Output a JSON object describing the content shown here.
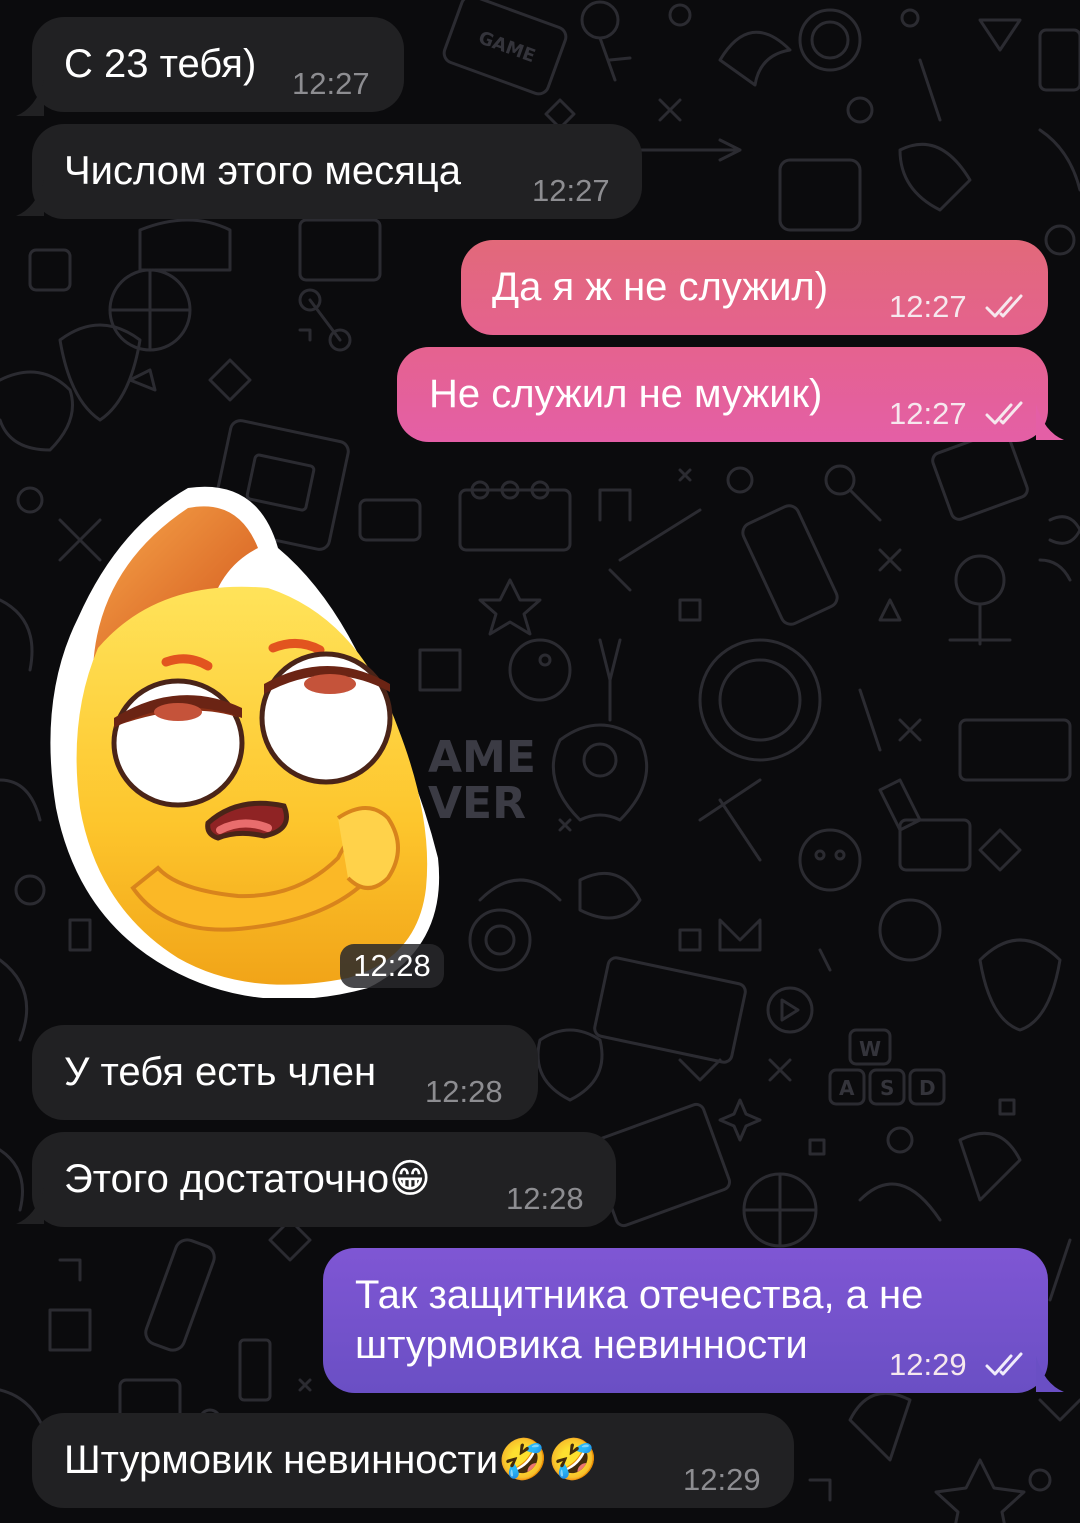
{
  "theme": {
    "incoming_bubble_color": "#212123",
    "outgoing_pink_start": "#e2607a",
    "outgoing_pink_end": "#e85f9c",
    "outgoing_purple_start": "#7f55d2",
    "outgoing_purple_end": "#6a4ec2",
    "background": "#0b0b0d"
  },
  "wallpaper": {
    "stamp_line1": "AME",
    "stamp_line2": "VER",
    "game_label": "GAME",
    "keys": [
      "W",
      "A",
      "S",
      "D"
    ]
  },
  "messages": [
    {
      "direction": "incoming",
      "text": "С 23 тебя)",
      "time": "12:27"
    },
    {
      "direction": "incoming",
      "text": "Числом этого месяца",
      "time": "12:27"
    },
    {
      "direction": "outgoing",
      "text": "Да я ж не служил)",
      "time": "12:27",
      "status": "read"
    },
    {
      "direction": "outgoing",
      "text": "Не служил не мужик)",
      "time": "12:27",
      "status": "read"
    },
    {
      "direction": "incoming",
      "type": "sticker",
      "sticker": "skeptical-yellow-blob-arms-crossed",
      "time": "12:28"
    },
    {
      "direction": "incoming",
      "text": "У тебя есть член",
      "time": "12:28"
    },
    {
      "direction": "incoming",
      "text": "Этого достаточно😁",
      "time": "12:28"
    },
    {
      "direction": "outgoing",
      "text_line1": "Так защитника отечества, а не",
      "text_line2": "штурмовика невинности",
      "time": "12:29",
      "status": "read"
    },
    {
      "direction": "incoming",
      "text": "Штурмовик невинности🤣🤣",
      "time": "12:29"
    }
  ]
}
